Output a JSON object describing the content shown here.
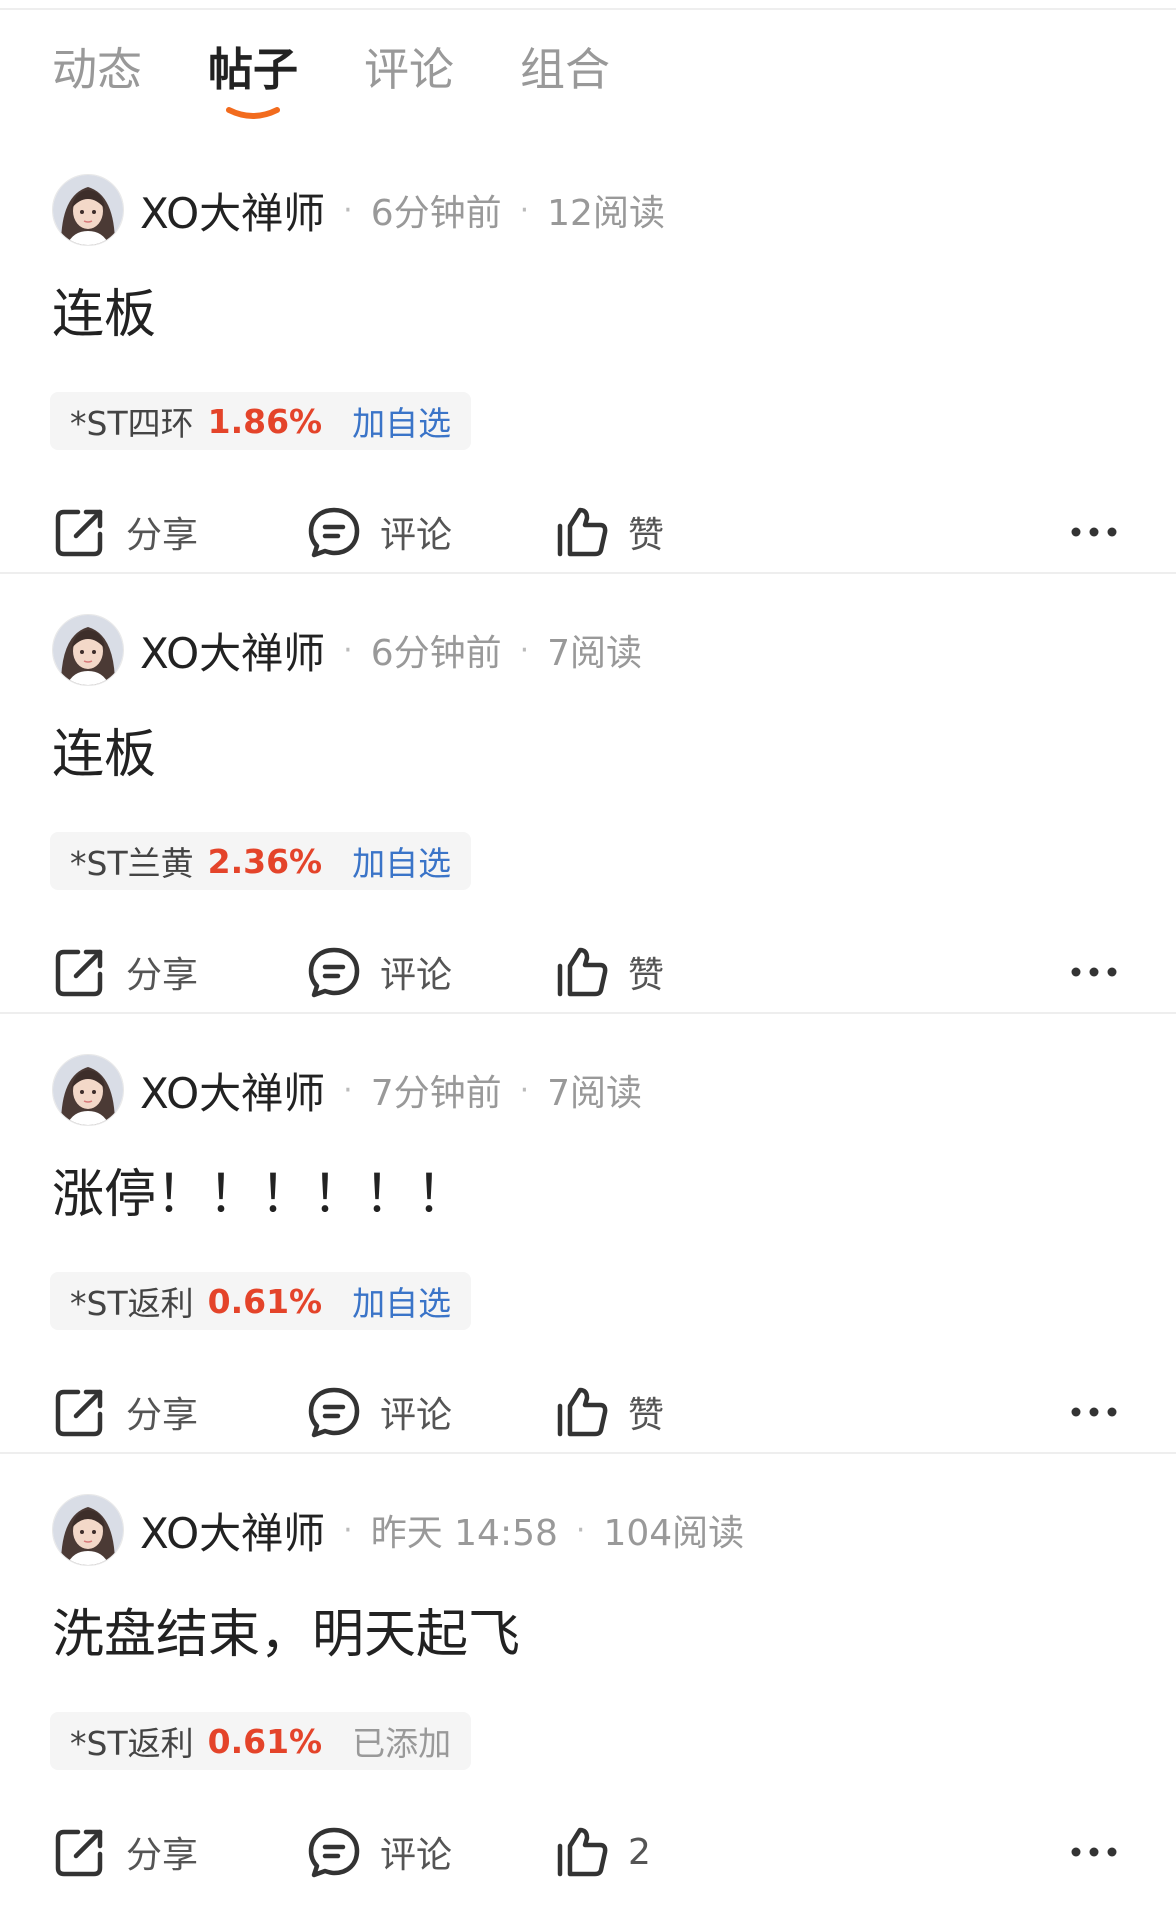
{
  "tabs": [
    {
      "label": "动态",
      "active": false
    },
    {
      "label": "帖子",
      "active": true
    },
    {
      "label": "评论",
      "active": false
    },
    {
      "label": "组合",
      "active": false
    }
  ],
  "colors": {
    "accent": "#f26b1d",
    "price_up": "#e4442a",
    "link": "#3a74c8",
    "muted": "#999999"
  },
  "actions": {
    "share_label": "分享",
    "comment_label": "评论",
    "like_label": "赞"
  },
  "posts": [
    {
      "author": "XO大禅师",
      "time": "6分钟前",
      "reads": "12阅读",
      "title": "连板",
      "stock": {
        "name": "*ST四环",
        "change": "1.86%",
        "action": "加自选"
      },
      "like": "赞"
    },
    {
      "author": "XO大禅师",
      "time": "6分钟前",
      "reads": "7阅读",
      "title": "连板",
      "stock": {
        "name": "*ST兰黄",
        "change": "2.36%",
        "action": "加自选"
      },
      "like": "赞"
    },
    {
      "author": "XO大禅师",
      "time": "7分钟前",
      "reads": "7阅读",
      "title": "涨停！！！！！！",
      "stock": {
        "name": "*ST返利",
        "change": "0.61%",
        "action": "加自选"
      },
      "like": "赞"
    },
    {
      "author": "XO大禅师",
      "time": "昨天 14:58",
      "reads": "104阅读",
      "title": "洗盘结束，明天起飞",
      "stock": {
        "name": "*ST返利",
        "change": "0.61%",
        "action": "已添加"
      },
      "like": "2"
    }
  ]
}
